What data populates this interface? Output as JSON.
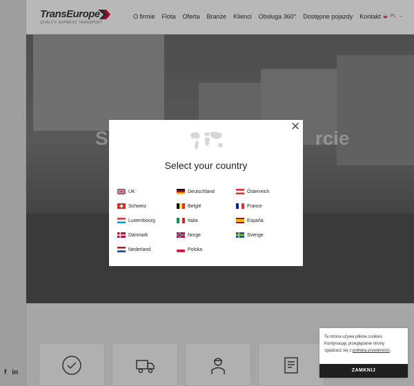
{
  "header": {
    "logo_text": "TransEurope",
    "logo_tagline": "QUALITY EXPRESS TRANSPORT",
    "nav": [
      "O firmie",
      "Flota",
      "Oferta",
      "Branże",
      "Klienci",
      "Obsługa 360°",
      "Dostępne pojazdy",
      "Kontakt"
    ],
    "lang": "PL"
  },
  "hero": {
    "headline_left": "S",
    "headline_right": "rcie"
  },
  "social": {
    "facebook": "f",
    "linkedin": "in"
  },
  "modal": {
    "title": "Select your country",
    "close_glyph": "✕",
    "countries": [
      "UK",
      "Deutschland",
      "Österreich",
      "Schweiz",
      "België",
      "France",
      "Luxembourg",
      "Italia",
      "España",
      "Danmark",
      "Norge",
      "Sverige",
      "Nederland",
      "Polska"
    ]
  },
  "cookie": {
    "text_1": "Ta strona używa plików cookies. Kontynuując przeglądanie strony zgadzasz się z ",
    "link": "polityką prywatności",
    "text_2": ".",
    "button": "ZAMKNIJ"
  },
  "colors": {
    "accent": "#c8102e",
    "dark": "#1f1f1f"
  }
}
